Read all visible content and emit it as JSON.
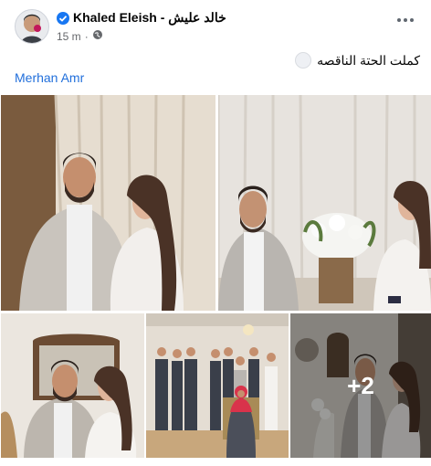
{
  "post": {
    "author": "Khaled Eleish - خالد عليش",
    "time": "15 m",
    "dot": "·",
    "caption": "كملت الحتة الناقصه",
    "tagged_user": "Merhan Amr"
  },
  "photos": {
    "more_count": "+2"
  },
  "colors": {
    "link": "#216fdb",
    "verified": "#1877f2",
    "muted_text": "#65676b"
  },
  "icons": [
    "verified-badge-icon",
    "globe-icon",
    "more-options-icon",
    "smile-emoji-icon"
  ]
}
